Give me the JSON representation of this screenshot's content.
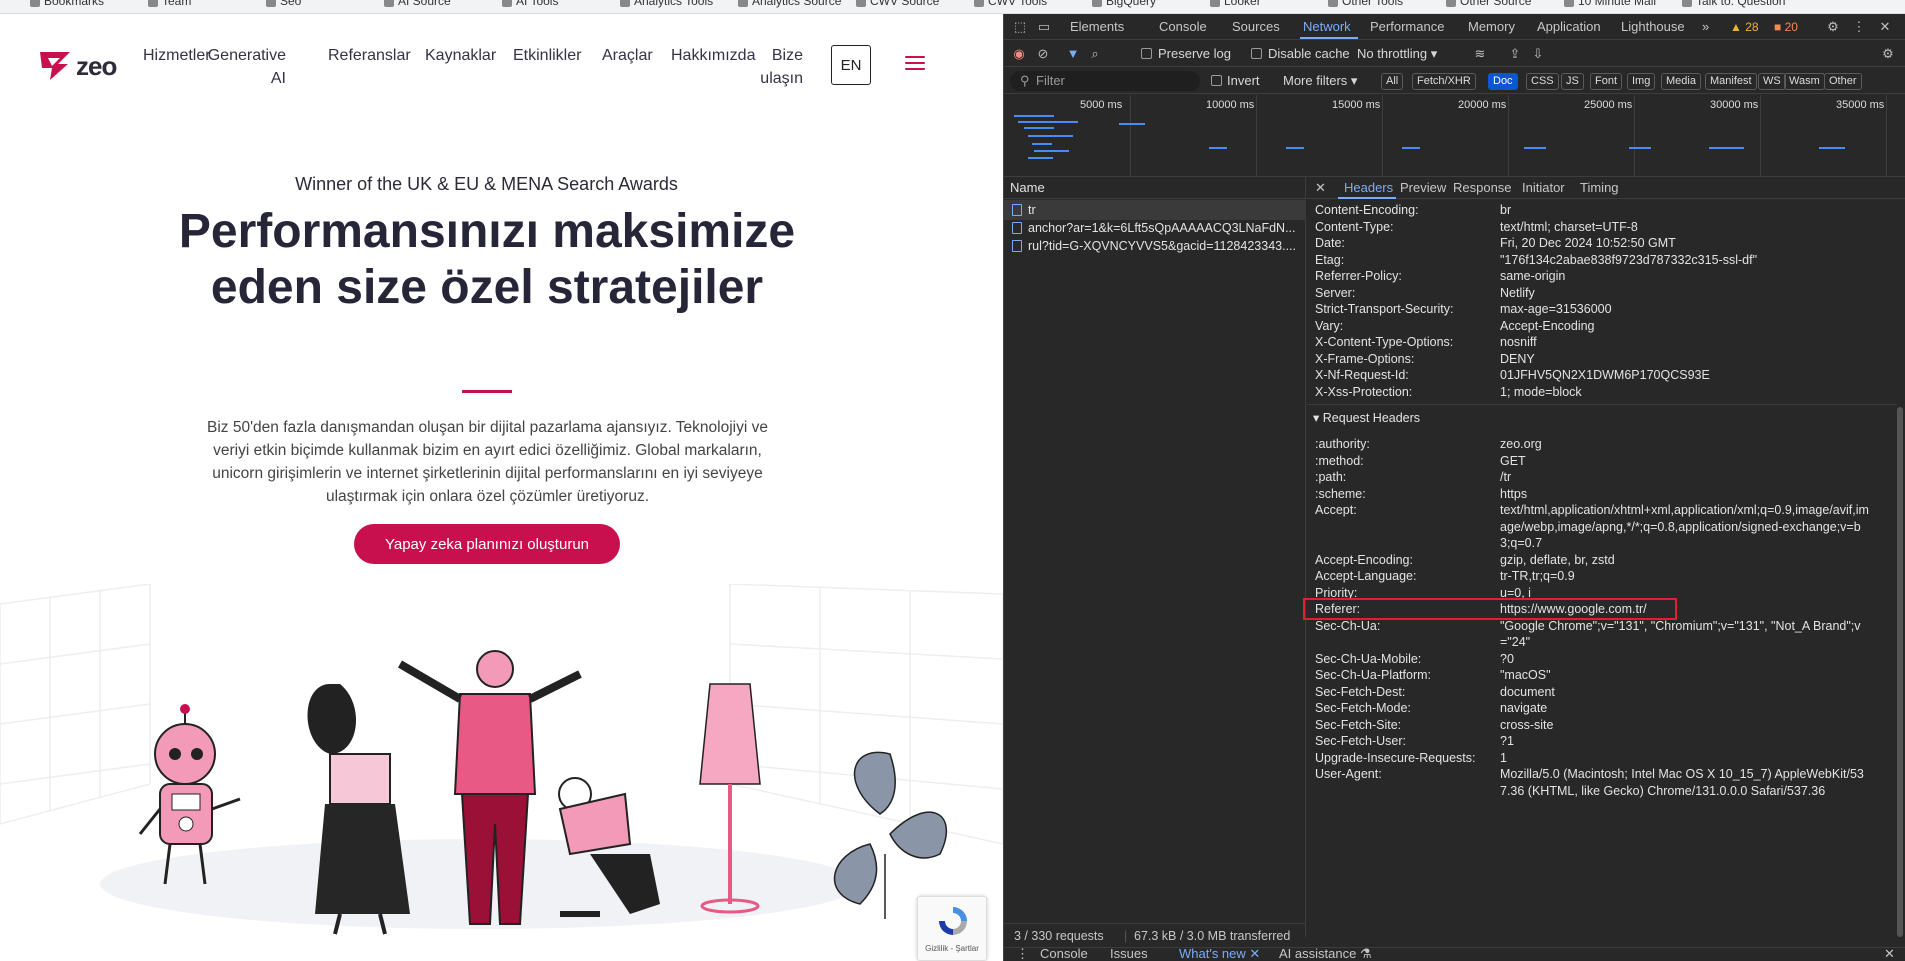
{
  "bookmarks": [
    "Bookmarks",
    "Team",
    "Seo",
    "AI Source",
    "AI Tools",
    "Analytics Tools",
    "Analytics Source",
    "CWV Source",
    "CWV Tools",
    "BigQuery",
    "Looker",
    "Other Tools",
    "Other Source",
    "10 Minute Mail",
    "Talk to: Question"
  ],
  "site": {
    "logo_text": "zeo",
    "nav": [
      "Hizmetler",
      "Generative AI",
      "Referanslar",
      "Kaynaklar",
      "Etkinlikler",
      "Araçlar",
      "Hakkımızda",
      "Bize ulaşın"
    ],
    "lang_button": "EN",
    "award": "Winner of the UK & EU & MENA Search Awards",
    "headline": "Performansınızı maksimize eden size özel stratejiler",
    "description": "Biz 50'den fazla danışmandan oluşan bir dijital pazarlama ajansıyız. Teknolojiyi ve veriyi etkin biçimde kullanmak bizim en ayırt edici özelliğimiz. Global markaların, unicorn girişimlerin ve internet şirketlerinin dijital performanslarını en iyi seviyeye ulaştırmak için onlara özel çözümler üretiyoruz.",
    "cta": "Yapay zeka planınızı oluşturun",
    "recaptcha_text": "Gizlilik - Şartlar"
  },
  "devtools": {
    "tabs": [
      "Elements",
      "Console",
      "Sources",
      "Network",
      "Performance",
      "Memory",
      "Application",
      "Lighthouse"
    ],
    "active_tab": "Network",
    "more_tabs": "»",
    "warnings_count": "28",
    "issues_count": "20",
    "toolbar": {
      "preserve_log": "Preserve log",
      "disable_cache": "Disable cache",
      "throttling": "No throttling"
    },
    "filter": {
      "placeholder": "Filter",
      "invert": "Invert",
      "more_filters": "More filters",
      "types": [
        "All",
        "Fetch/XHR",
        "Doc",
        "CSS",
        "JS",
        "Font",
        "Img",
        "Media",
        "Manifest",
        "WS",
        "Wasm",
        "Other"
      ],
      "active_type": "Doc"
    },
    "timeline_labels": [
      "5000 ms",
      "10000 ms",
      "15000 ms",
      "20000 ms",
      "25000 ms",
      "30000 ms",
      "35000 ms"
    ],
    "request_list": {
      "header": "Name",
      "rows": [
        "tr",
        "anchor?ar=1&k=6Lft5sQpAAAAACQ3LNaFdN...",
        "rul?tid=G-XQVNCYVVS5&gacid=1128423343...."
      ]
    },
    "detail_tabs": [
      "Headers",
      "Preview",
      "Response",
      "Initiator",
      "Timing"
    ],
    "active_detail_tab": "Headers",
    "response_headers": [
      {
        "name": "Content-Encoding:",
        "value": "br"
      },
      {
        "name": "Content-Type:",
        "value": "text/html; charset=UTF-8"
      },
      {
        "name": "Date:",
        "value": "Fri, 20 Dec 2024 10:52:50 GMT"
      },
      {
        "name": "Etag:",
        "value": "\"176f134c2abae838f9723d787332c315-ssl-df\""
      },
      {
        "name": "Referrer-Policy:",
        "value": "same-origin"
      },
      {
        "name": "Server:",
        "value": "Netlify"
      },
      {
        "name": "Strict-Transport-Security:",
        "value": "max-age=31536000"
      },
      {
        "name": "Vary:",
        "value": "Accept-Encoding"
      },
      {
        "name": "X-Content-Type-Options:",
        "value": "nosniff"
      },
      {
        "name": "X-Frame-Options:",
        "value": "DENY"
      },
      {
        "name": "X-Nf-Request-Id:",
        "value": "01JFHV5QN2X1DWM6P170QCS93E"
      },
      {
        "name": "X-Xss-Protection:",
        "value": "1; mode=block"
      }
    ],
    "request_headers_title": "Request Headers",
    "request_headers": [
      {
        "name": ":authority:",
        "value": "zeo.org"
      },
      {
        "name": ":method:",
        "value": "GET"
      },
      {
        "name": ":path:",
        "value": "/tr"
      },
      {
        "name": ":scheme:",
        "value": "https"
      },
      {
        "name": "Accept:",
        "value": "text/html,application/xhtml+xml,application/xml;q=0.9,image/avif,image/webp,image/apng,*/*;q=0.8,application/signed-exchange;v=b3;q=0.7"
      },
      {
        "name": "Accept-Encoding:",
        "value": "gzip, deflate, br, zstd"
      },
      {
        "name": "Accept-Language:",
        "value": "tr-TR,tr;q=0.9"
      },
      {
        "name": "Priority:",
        "value": "u=0, i"
      },
      {
        "name": "Referer:",
        "value": "https://www.google.com.tr/"
      },
      {
        "name": "Sec-Ch-Ua:",
        "value": "\"Google Chrome\";v=\"131\", \"Chromium\";v=\"131\", \"Not_A Brand\";v=\"24\""
      },
      {
        "name": "Sec-Ch-Ua-Mobile:",
        "value": "?0"
      },
      {
        "name": "Sec-Ch-Ua-Platform:",
        "value": "\"macOS\""
      },
      {
        "name": "Sec-Fetch-Dest:",
        "value": "document"
      },
      {
        "name": "Sec-Fetch-Mode:",
        "value": "navigate"
      },
      {
        "name": "Sec-Fetch-Site:",
        "value": "cross-site"
      },
      {
        "name": "Sec-Fetch-User:",
        "value": "?1"
      },
      {
        "name": "Upgrade-Insecure-Requests:",
        "value": "1"
      },
      {
        "name": "User-Agent:",
        "value": "Mozilla/5.0 (Macintosh; Intel Mac OS X 10_15_7) AppleWebKit/537.36 (KHTML, like Gecko) Chrome/131.0.0.0 Safari/537.36"
      }
    ],
    "status": {
      "requests": "3 / 330 requests",
      "transferred": "67.3 kB / 3.0 MB transferred"
    },
    "drawer_tabs": [
      "Console",
      "Issues",
      "What's new",
      "AI assistance"
    ],
    "active_drawer_tab": "What's new",
    "colors": {
      "accent": "#7cacf8",
      "brand": "#c8104f",
      "highlight": "#e0202f"
    }
  }
}
